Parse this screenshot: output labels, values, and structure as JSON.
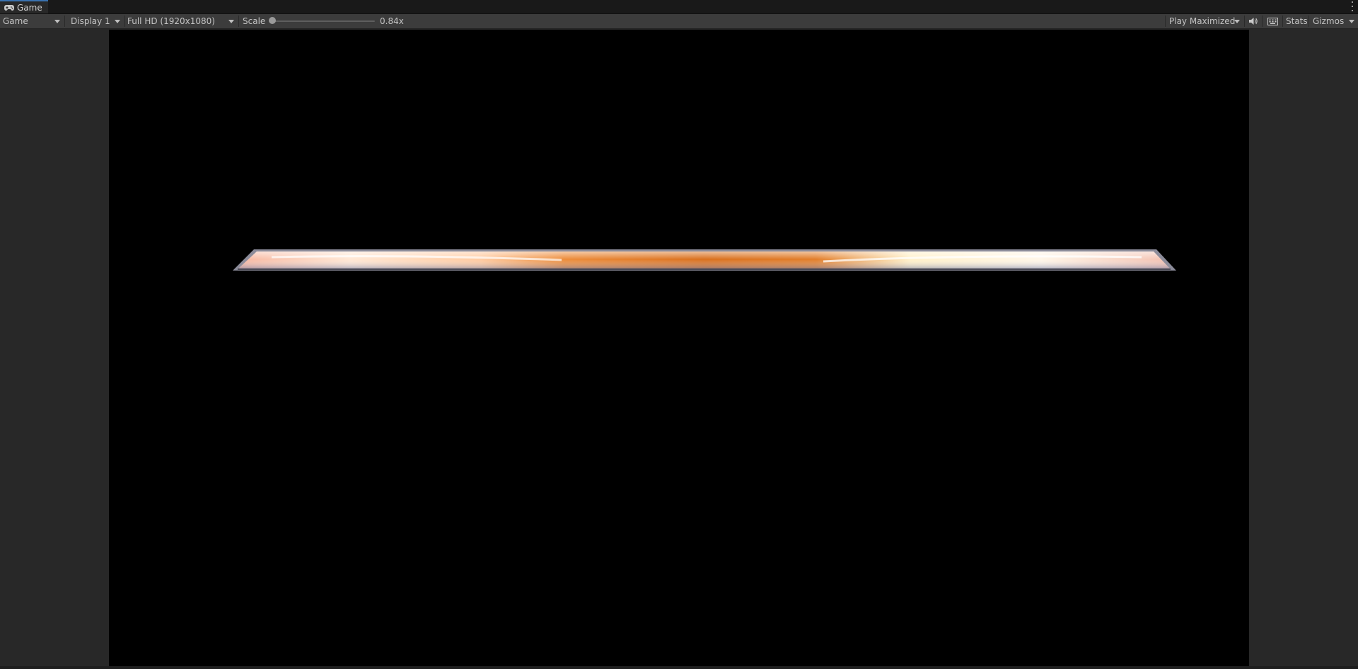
{
  "window": {
    "tab_label": "Game",
    "tab_icon": "gamepad-icon",
    "menu_icon": "kebab-menu-icon"
  },
  "toolbar": {
    "view_mode": "Game",
    "display": "Display 1",
    "resolution": "Full HD (1920x1080)",
    "scale_label": "Scale",
    "scale_value": "0.84x",
    "scale_level_fraction": 0.0,
    "play_mode": "Play Maximized",
    "audio_icon": "speaker-icon",
    "keyboard_icon": "keyboard-icon",
    "stats_label": "Stats",
    "gizmos_label": "Gizmos"
  },
  "scene": {
    "background_color": "#000000",
    "bar_colors": [
      "#f2a07a",
      "#e07b2c",
      "#fff4d8",
      "#9fa6c0"
    ]
  },
  "colors": {
    "panel": "#282828",
    "toolbar": "#3c3c3c",
    "tabbar": "#191919",
    "accent": "#3a72b0"
  }
}
